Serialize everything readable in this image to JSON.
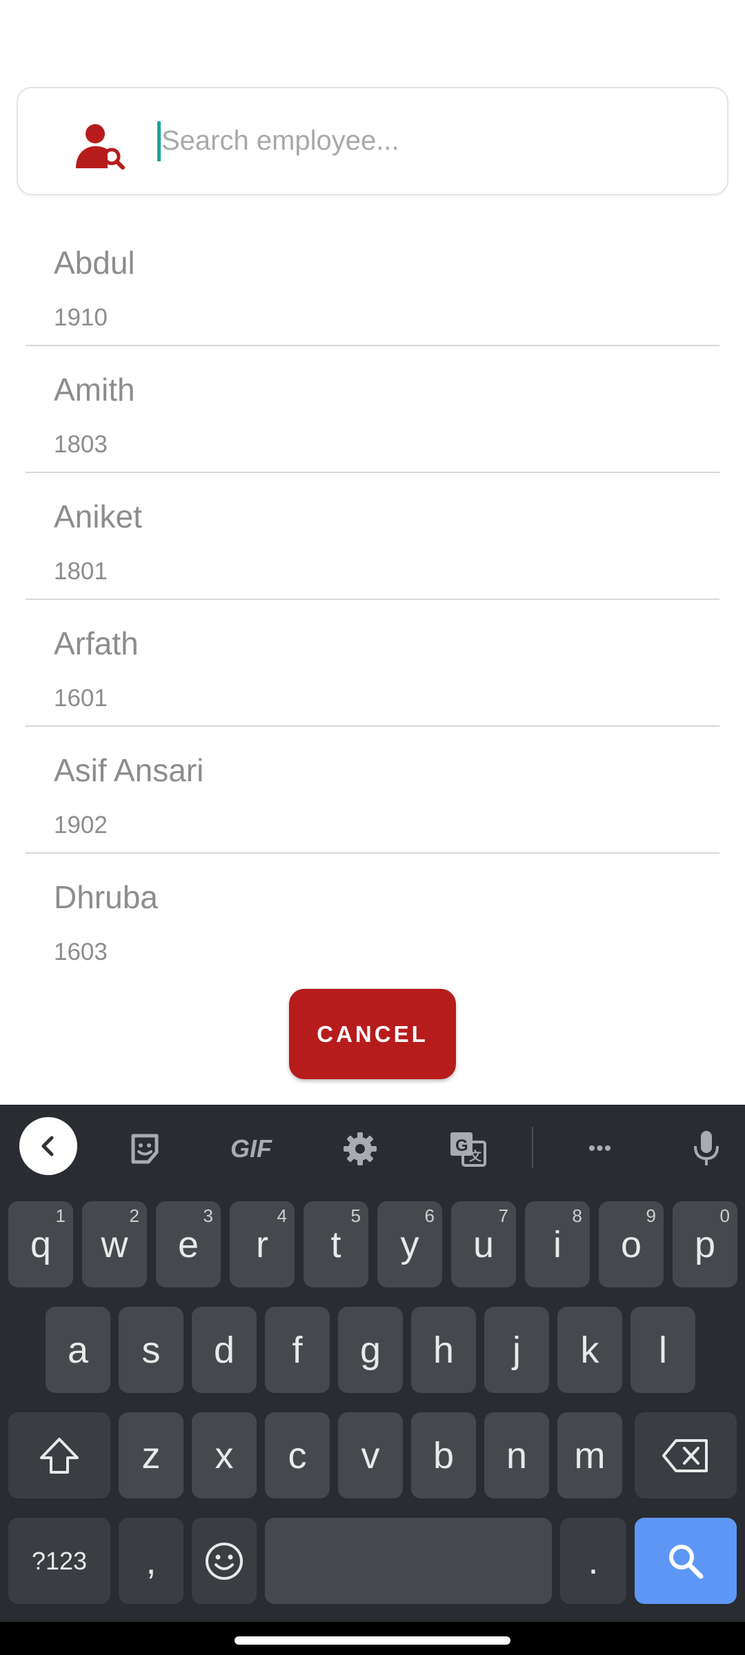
{
  "search": {
    "placeholder": "Search employee...",
    "value": "",
    "icon": "person-search-icon",
    "accent_color": "#b71c1c",
    "caret_color": "#1aa39a"
  },
  "employees": [
    {
      "name": "Abdul",
      "code": "1910"
    },
    {
      "name": "Amith",
      "code": "1803"
    },
    {
      "name": "Aniket",
      "code": "1801"
    },
    {
      "name": "Arfath",
      "code": "1601"
    },
    {
      "name": "Asif Ansari",
      "code": "1902"
    },
    {
      "name": "Dhruba",
      "code": "1603"
    }
  ],
  "cancel_label": "CANCEL",
  "keyboard": {
    "toolbar": {
      "icons": [
        "back-icon",
        "sticker-icon",
        "gif-icon",
        "settings-icon",
        "translate-icon",
        "more-icon",
        "mic-icon"
      ],
      "gif_label": "GIF",
      "more_label": "•••"
    },
    "row1": [
      {
        "k": "q",
        "h": "1"
      },
      {
        "k": "w",
        "h": "2"
      },
      {
        "k": "e",
        "h": "3"
      },
      {
        "k": "r",
        "h": "4"
      },
      {
        "k": "t",
        "h": "5"
      },
      {
        "k": "y",
        "h": "6"
      },
      {
        "k": "u",
        "h": "7"
      },
      {
        "k": "i",
        "h": "8"
      },
      {
        "k": "o",
        "h": "9"
      },
      {
        "k": "p",
        "h": "0"
      }
    ],
    "row2": [
      "a",
      "s",
      "d",
      "f",
      "g",
      "h",
      "j",
      "k",
      "l"
    ],
    "row3": [
      "z",
      "x",
      "c",
      "v",
      "b",
      "n",
      "m"
    ],
    "symbols_label": "?123",
    "comma_label": ",",
    "period_label": ".",
    "search_key_color": "#5e97f6"
  }
}
